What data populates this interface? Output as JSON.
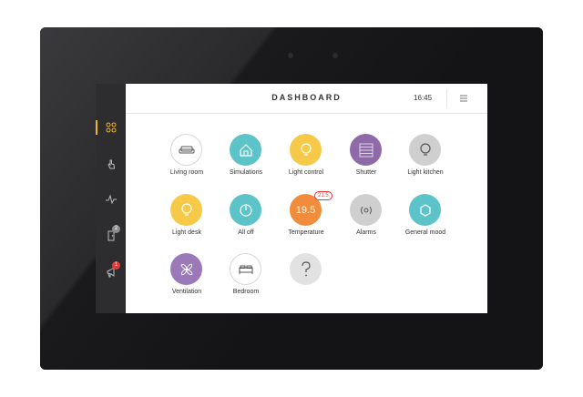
{
  "header": {
    "title": "DASHBOARD",
    "time": "16:45"
  },
  "sidebar": {
    "accent_color": "#f0b429",
    "items": [
      {
        "icon": "grid-icon",
        "active": true
      },
      {
        "icon": "hand-touch-icon"
      },
      {
        "icon": "pulse-icon"
      },
      {
        "icon": "door-icon",
        "badge": "2"
      },
      {
        "icon": "megaphone-icon",
        "badge": "1"
      }
    ]
  },
  "tiles": [
    {
      "label": "Living room",
      "icon": "sofa-icon",
      "color": "#ffffff"
    },
    {
      "label": "Simulations",
      "icon": "house-icon",
      "color": "#5cc4c9"
    },
    {
      "label": "Light control",
      "icon": "bulb-icon",
      "color": "#f7c948"
    },
    {
      "label": "Shutter",
      "icon": "shutter-icon",
      "color": "#8e6aa8"
    },
    {
      "label": "Light kitchen",
      "icon": "bulb-icon",
      "color": "#cfcfcf"
    },
    {
      "label": "Light desk",
      "icon": "bulb-icon",
      "color": "#f7c948"
    },
    {
      "label": "All off",
      "icon": "power-icon",
      "color": "#5cc4c9"
    },
    {
      "label": "Temperature",
      "icon": "thermometer-icon",
      "color": "#f08c3c",
      "value": "19.5",
      "setpoint": "21.5"
    },
    {
      "label": "Alarms",
      "icon": "alarm-icon",
      "color": "#cfcfcf"
    },
    {
      "label": "General mood",
      "icon": "hexagon-icon",
      "color": "#5cc4c9"
    },
    {
      "label": "Ventilation",
      "icon": "fan-icon",
      "color": "#9b79b8"
    },
    {
      "label": "Bedroom",
      "icon": "bed-icon",
      "color": "#ffffff"
    },
    {
      "label": "",
      "icon": "question-icon",
      "color": "#e2e2e2"
    }
  ],
  "colors": {
    "badge_gray": "#8c8c8c",
    "badge_red": "#e33b3b"
  }
}
